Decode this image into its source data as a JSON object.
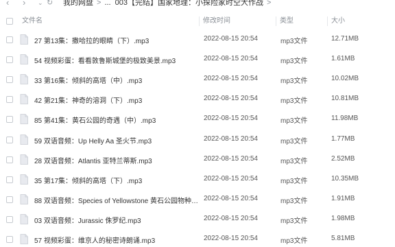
{
  "nav": {
    "back_icon": "chevron-left-icon",
    "forward_icon": "chevron-right-icon",
    "dropdown_icon": "chevron-down-icon",
    "refresh_icon": "refresh-icon"
  },
  "breadcrumb": {
    "root": "我的网盘",
    "sep": ">",
    "ellipsis": "...",
    "current": "003【完结】国家地理：小探险家时空大作战",
    "trail_sep": ">"
  },
  "table": {
    "headers": {
      "name": "文件名",
      "date": "修改时间",
      "type": "类型",
      "size": "大小"
    },
    "rows": [
      {
        "name": "27 第13集：撒哈拉的眼睛（下）.mp3",
        "date": "2022-08-15 20:54",
        "type": "mp3文件",
        "size": "12.71MB"
      },
      {
        "name": "54 视频彩蛋：看看敦鲁斯城堡的极致美景.mp3",
        "date": "2022-08-15 20:54",
        "type": "mp3文件",
        "size": "1.61MB"
      },
      {
        "name": "33 第16集：倾斜的高塔（中）.mp3",
        "date": "2022-08-15 20:54",
        "type": "mp3文件",
        "size": "10.02MB"
      },
      {
        "name": "42 第21集：神奇的溶洞（下）.mp3",
        "date": "2022-08-15 20:54",
        "type": "mp3文件",
        "size": "10.81MB"
      },
      {
        "name": "85 第41集：黄石公园的奇遇（中）.mp3",
        "date": "2022-08-15 20:54",
        "type": "mp3文件",
        "size": "11.98MB"
      },
      {
        "name": "59 双语音频：Up Helly Aa 圣火节.mp3",
        "date": "2022-08-15 20:54",
        "type": "mp3文件",
        "size": "1.77MB"
      },
      {
        "name": "28 双语音频：Atlantis 亚特兰蒂斯.mp3",
        "date": "2022-08-15 20:54",
        "type": "mp3文件",
        "size": "2.52MB"
      },
      {
        "name": "35 第17集：倾斜的高塔（下）.mp3",
        "date": "2022-08-15 20:54",
        "type": "mp3文件",
        "size": "10.35MB"
      },
      {
        "name": "88 双语音频：Species of Yellowstone 黄石公园物种.m...",
        "date": "2022-08-15 20:54",
        "type": "mp3文件",
        "size": "1.91MB"
      },
      {
        "name": "03 双语音频：Jurassic 侏罗纪.mp3",
        "date": "2022-08-15 20:54",
        "type": "mp3文件",
        "size": "1.98MB"
      },
      {
        "name": "57 视频彩蛋：维京人的秘密诗朗诵.mp3",
        "date": "2022-08-15 20:54",
        "type": "mp3文件",
        "size": "5.81MB"
      }
    ]
  },
  "colors": {
    "icon_fill": "#e8eaef",
    "icon_stroke": "#c9cdd4",
    "text": "#333333",
    "muted": "#8a8f96"
  }
}
